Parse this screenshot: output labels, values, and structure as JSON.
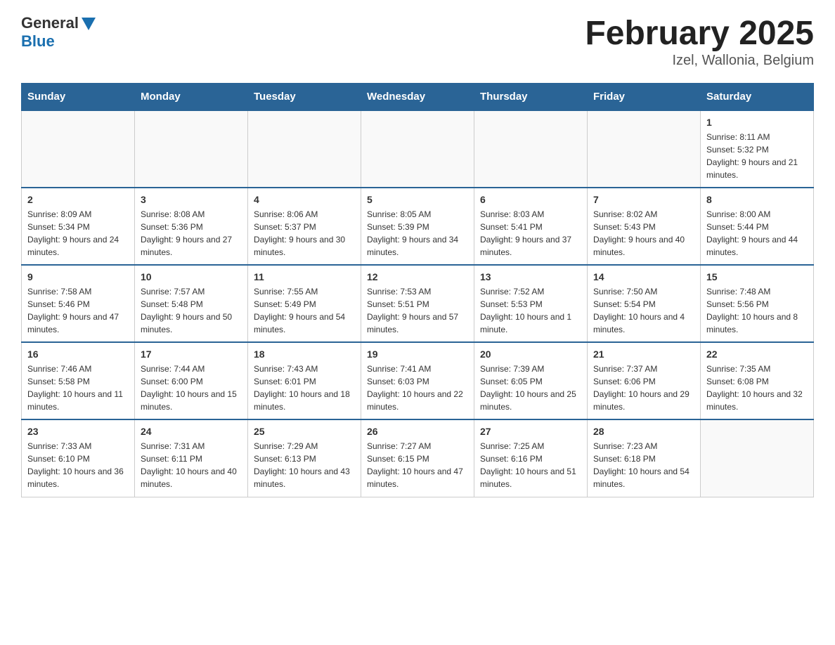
{
  "logo": {
    "general": "General",
    "blue": "Blue"
  },
  "title": "February 2025",
  "location": "Izel, Wallonia, Belgium",
  "days_header": [
    "Sunday",
    "Monday",
    "Tuesday",
    "Wednesday",
    "Thursday",
    "Friday",
    "Saturday"
  ],
  "weeks": [
    [
      {
        "day": "",
        "info": ""
      },
      {
        "day": "",
        "info": ""
      },
      {
        "day": "",
        "info": ""
      },
      {
        "day": "",
        "info": ""
      },
      {
        "day": "",
        "info": ""
      },
      {
        "day": "",
        "info": ""
      },
      {
        "day": "1",
        "info": "Sunrise: 8:11 AM\nSunset: 5:32 PM\nDaylight: 9 hours and 21 minutes."
      }
    ],
    [
      {
        "day": "2",
        "info": "Sunrise: 8:09 AM\nSunset: 5:34 PM\nDaylight: 9 hours and 24 minutes."
      },
      {
        "day": "3",
        "info": "Sunrise: 8:08 AM\nSunset: 5:36 PM\nDaylight: 9 hours and 27 minutes."
      },
      {
        "day": "4",
        "info": "Sunrise: 8:06 AM\nSunset: 5:37 PM\nDaylight: 9 hours and 30 minutes."
      },
      {
        "day": "5",
        "info": "Sunrise: 8:05 AM\nSunset: 5:39 PM\nDaylight: 9 hours and 34 minutes."
      },
      {
        "day": "6",
        "info": "Sunrise: 8:03 AM\nSunset: 5:41 PM\nDaylight: 9 hours and 37 minutes."
      },
      {
        "day": "7",
        "info": "Sunrise: 8:02 AM\nSunset: 5:43 PM\nDaylight: 9 hours and 40 minutes."
      },
      {
        "day": "8",
        "info": "Sunrise: 8:00 AM\nSunset: 5:44 PM\nDaylight: 9 hours and 44 minutes."
      }
    ],
    [
      {
        "day": "9",
        "info": "Sunrise: 7:58 AM\nSunset: 5:46 PM\nDaylight: 9 hours and 47 minutes."
      },
      {
        "day": "10",
        "info": "Sunrise: 7:57 AM\nSunset: 5:48 PM\nDaylight: 9 hours and 50 minutes."
      },
      {
        "day": "11",
        "info": "Sunrise: 7:55 AM\nSunset: 5:49 PM\nDaylight: 9 hours and 54 minutes."
      },
      {
        "day": "12",
        "info": "Sunrise: 7:53 AM\nSunset: 5:51 PM\nDaylight: 9 hours and 57 minutes."
      },
      {
        "day": "13",
        "info": "Sunrise: 7:52 AM\nSunset: 5:53 PM\nDaylight: 10 hours and 1 minute."
      },
      {
        "day": "14",
        "info": "Sunrise: 7:50 AM\nSunset: 5:54 PM\nDaylight: 10 hours and 4 minutes."
      },
      {
        "day": "15",
        "info": "Sunrise: 7:48 AM\nSunset: 5:56 PM\nDaylight: 10 hours and 8 minutes."
      }
    ],
    [
      {
        "day": "16",
        "info": "Sunrise: 7:46 AM\nSunset: 5:58 PM\nDaylight: 10 hours and 11 minutes."
      },
      {
        "day": "17",
        "info": "Sunrise: 7:44 AM\nSunset: 6:00 PM\nDaylight: 10 hours and 15 minutes."
      },
      {
        "day": "18",
        "info": "Sunrise: 7:43 AM\nSunset: 6:01 PM\nDaylight: 10 hours and 18 minutes."
      },
      {
        "day": "19",
        "info": "Sunrise: 7:41 AM\nSunset: 6:03 PM\nDaylight: 10 hours and 22 minutes."
      },
      {
        "day": "20",
        "info": "Sunrise: 7:39 AM\nSunset: 6:05 PM\nDaylight: 10 hours and 25 minutes."
      },
      {
        "day": "21",
        "info": "Sunrise: 7:37 AM\nSunset: 6:06 PM\nDaylight: 10 hours and 29 minutes."
      },
      {
        "day": "22",
        "info": "Sunrise: 7:35 AM\nSunset: 6:08 PM\nDaylight: 10 hours and 32 minutes."
      }
    ],
    [
      {
        "day": "23",
        "info": "Sunrise: 7:33 AM\nSunset: 6:10 PM\nDaylight: 10 hours and 36 minutes."
      },
      {
        "day": "24",
        "info": "Sunrise: 7:31 AM\nSunset: 6:11 PM\nDaylight: 10 hours and 40 minutes."
      },
      {
        "day": "25",
        "info": "Sunrise: 7:29 AM\nSunset: 6:13 PM\nDaylight: 10 hours and 43 minutes."
      },
      {
        "day": "26",
        "info": "Sunrise: 7:27 AM\nSunset: 6:15 PM\nDaylight: 10 hours and 47 minutes."
      },
      {
        "day": "27",
        "info": "Sunrise: 7:25 AM\nSunset: 6:16 PM\nDaylight: 10 hours and 51 minutes."
      },
      {
        "day": "28",
        "info": "Sunrise: 7:23 AM\nSunset: 6:18 PM\nDaylight: 10 hours and 54 minutes."
      },
      {
        "day": "",
        "info": ""
      }
    ]
  ]
}
